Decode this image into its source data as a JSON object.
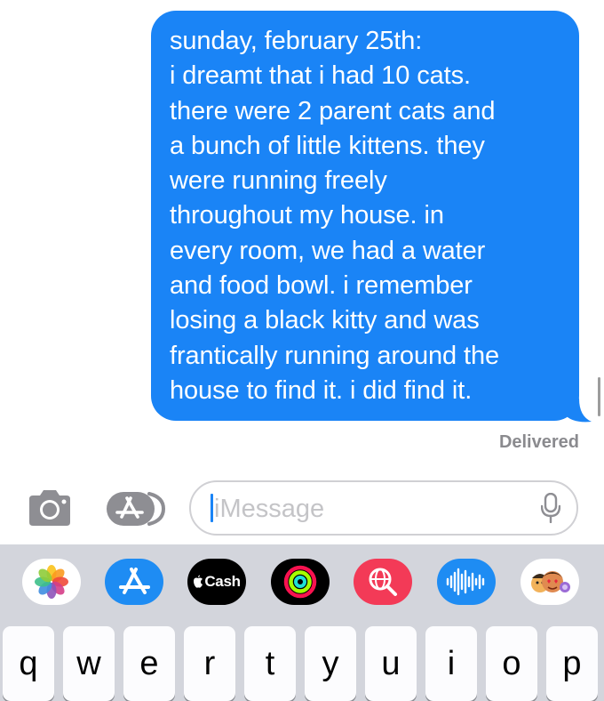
{
  "message": {
    "text": "sunday, february 25th:\ni dreamt that i had 10 cats.\nthere were 2 parent cats and\na bunch of little kittens. they\nwere running freely\nthroughout my house. in\nevery room, we had a water\nand food bowl. i remember\nlosing a black kitty and was\nfrantically running around the\nhouse to find it. i did find it.",
    "status": "Delivered",
    "bubble_color": "#1a84f6"
  },
  "input": {
    "placeholder": "iMessage"
  },
  "toolbar": {
    "camera_icon": "camera-icon",
    "apps_icon": "app-store-icon",
    "mic_icon": "microphone-icon"
  },
  "app_strip": [
    {
      "name": "photos",
      "icon": "photos-icon"
    },
    {
      "name": "app-store",
      "icon": "app-store-icon"
    },
    {
      "name": "apple-cash",
      "label": "Cash"
    },
    {
      "name": "activity",
      "icon": "activity-rings-icon"
    },
    {
      "name": "search-images",
      "icon": "globe-search-icon"
    },
    {
      "name": "audio",
      "icon": "audio-waveform-icon"
    },
    {
      "name": "memoji",
      "icon": "memoji-icon"
    }
  ],
  "keyboard": {
    "row1": [
      "q",
      "w",
      "e",
      "r",
      "t",
      "y",
      "u",
      "i",
      "o",
      "p"
    ]
  }
}
